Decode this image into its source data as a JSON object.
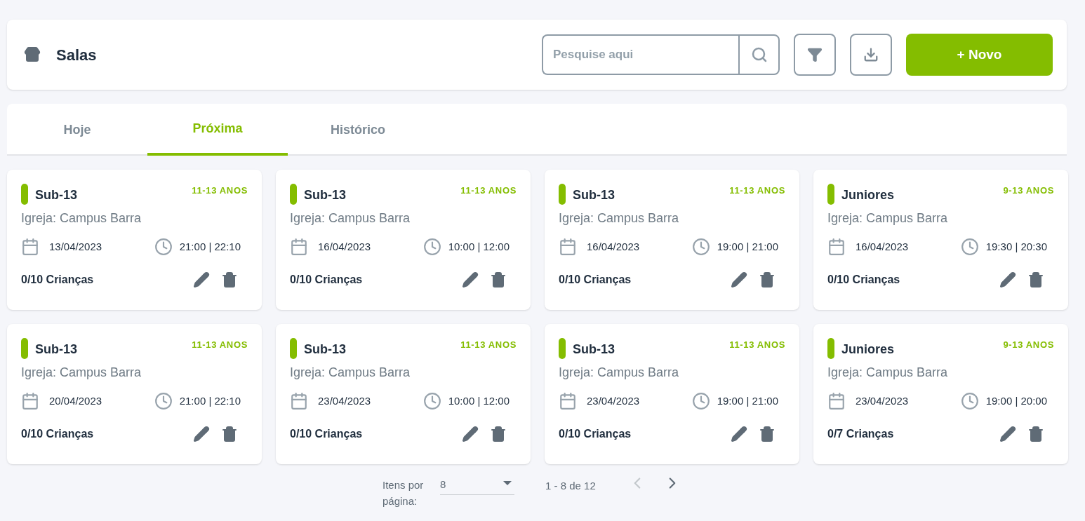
{
  "header": {
    "title": "Salas",
    "search": {
      "placeholder": "Pesquise aqui"
    },
    "new_button": "+ Novo"
  },
  "tabs": [
    {
      "label": "Hoje",
      "selected": false
    },
    {
      "label": "Próxima",
      "selected": true
    },
    {
      "label": "Histórico",
      "selected": false
    }
  ],
  "rooms": [
    {
      "name": "Sub-13",
      "age": "11-13 ANOS",
      "church": "Igreja: Campus Barra",
      "date": "13/04/2023",
      "time": "21:00 | 22:10",
      "capacity": "0/10 Crianças"
    },
    {
      "name": "Sub-13",
      "age": "11-13 ANOS",
      "church": "Igreja: Campus Barra",
      "date": "16/04/2023",
      "time": "10:00 | 12:00",
      "capacity": "0/10 Crianças"
    },
    {
      "name": "Sub-13",
      "age": "11-13 ANOS",
      "church": "Igreja: Campus Barra",
      "date": "16/04/2023",
      "time": "19:00 | 21:00",
      "capacity": "0/10 Crianças"
    },
    {
      "name": "Juniores",
      "age": "9-13 ANOS",
      "church": "Igreja: Campus Barra",
      "date": "16/04/2023",
      "time": "19:30 | 20:30",
      "capacity": "0/10 Crianças"
    },
    {
      "name": "Sub-13",
      "age": "11-13 ANOS",
      "church": "Igreja: Campus Barra",
      "date": "20/04/2023",
      "time": "21:00 | 22:10",
      "capacity": "0/10 Crianças"
    },
    {
      "name": "Sub-13",
      "age": "11-13 ANOS",
      "church": "Igreja: Campus Barra",
      "date": "23/04/2023",
      "time": "10:00 | 12:00",
      "capacity": "0/10 Crianças"
    },
    {
      "name": "Sub-13",
      "age": "11-13 ANOS",
      "church": "Igreja: Campus Barra",
      "date": "23/04/2023",
      "time": "19:00 | 21:00",
      "capacity": "0/10 Crianças"
    },
    {
      "name": "Juniores",
      "age": "9-13 ANOS",
      "church": "Igreja: Campus Barra",
      "date": "23/04/2023",
      "time": "19:00 | 20:00",
      "capacity": "0/7 Crianças"
    }
  ],
  "pagination": {
    "items_label": "Itens por página:",
    "page_size": "8",
    "range": "1 - 8 de 12",
    "prev_disabled": true,
    "next_disabled": false
  }
}
